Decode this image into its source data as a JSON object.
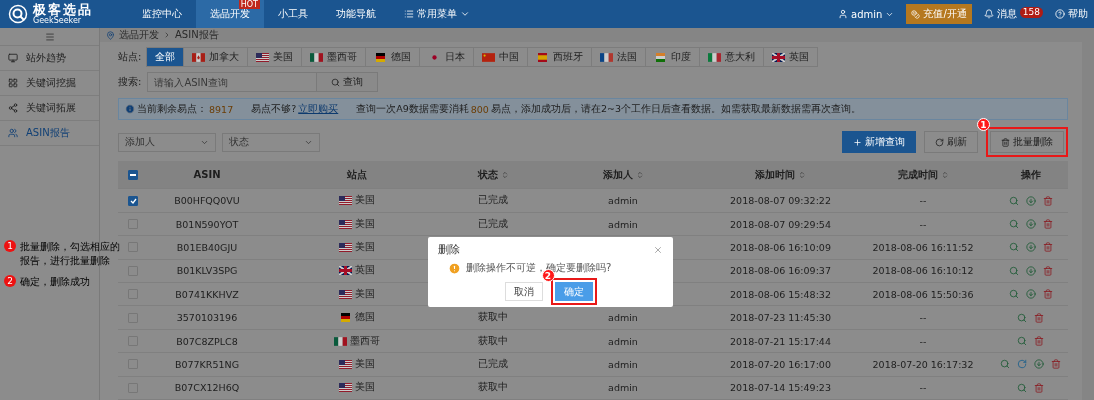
{
  "header": {
    "logo": {
      "name": "极客选品",
      "subtitle": "GeekSeeker"
    },
    "nav": [
      {
        "label": "监控中心",
        "selected": false
      },
      {
        "label": "选品开发",
        "selected": true,
        "badge": "HOT"
      },
      {
        "label": "小工具",
        "selected": false
      },
      {
        "label": "功能导航",
        "selected": false
      }
    ],
    "menu": {
      "label": "常用菜单"
    },
    "user": {
      "name": "admin"
    },
    "recharge": {
      "label": "充值/开通"
    },
    "messages": {
      "label": "消息",
      "count": "158"
    },
    "help": {
      "label": "帮助"
    }
  },
  "sidebar": {
    "items": [
      {
        "label": "站外趋势",
        "kind": "monitor",
        "selected": false
      },
      {
        "label": "关键词挖掘",
        "kind": "grid",
        "selected": false
      },
      {
        "label": "关键词拓展",
        "kind": "share",
        "selected": false
      },
      {
        "label": "ASIN报告",
        "kind": "users",
        "selected": true
      }
    ]
  },
  "breadcrumb": [
    "选品开发",
    "ASIN报告"
  ],
  "filters": {
    "site_label": "站点:",
    "sites": [
      {
        "label": "全部",
        "kind": "all",
        "selected": true
      },
      {
        "label": "加拿大",
        "kind": "ca",
        "selected": false
      },
      {
        "label": "美国",
        "kind": "us",
        "selected": false
      },
      {
        "label": "墨西哥",
        "kind": "mx",
        "selected": false
      },
      {
        "label": "德国",
        "kind": "de",
        "selected": false
      },
      {
        "label": "日本",
        "kind": "jp",
        "selected": false
      },
      {
        "label": "中国",
        "kind": "cn",
        "selected": false
      },
      {
        "label": "西班牙",
        "kind": "es",
        "selected": false
      },
      {
        "label": "法国",
        "kind": "fr",
        "selected": false
      },
      {
        "label": "印度",
        "kind": "in",
        "selected": false
      },
      {
        "label": "意大利",
        "kind": "it",
        "selected": false
      },
      {
        "label": "英国",
        "kind": "gb",
        "selected": false
      }
    ],
    "search_label": "搜索:",
    "search_placeholder": "请输入ASIN查询",
    "search_button": "查询"
  },
  "info": {
    "balance_label": "当前剩余易点：",
    "balance": "8917",
    "prompt": "易点不够?",
    "link": "立即购买",
    "notice_before": "查询一次A9数据需要消耗",
    "cost": "800",
    "notice_after": "易点，添加成功后，请在2~3个工作日后查看数据。如需获取最新数据需再次查询。"
  },
  "toolbar": {
    "selects": [
      {
        "placeholder": "添加人"
      },
      {
        "placeholder": "状态"
      }
    ],
    "buttons": [
      {
        "label": "新增查询",
        "kind": "add"
      },
      {
        "label": "刷新",
        "kind": "refresh"
      },
      {
        "label": "批量删除",
        "kind": "delete",
        "marker": "1"
      }
    ]
  },
  "table": {
    "select_all": {
      "checked": true,
      "indeterminate": true
    },
    "columns": [
      {
        "label": "ASIN",
        "sortable": false
      },
      {
        "label": "站点",
        "sortable": false
      },
      {
        "label": "状态",
        "sortable": true
      },
      {
        "label": "添加人",
        "sortable": true
      },
      {
        "label": "添加时间",
        "sortable": true
      },
      {
        "label": "完成时间",
        "sortable": true
      },
      {
        "label": "操作",
        "sortable": false
      }
    ],
    "rows": [
      {
        "checked": true,
        "asin": "B00HFQQ0VU",
        "site": "美国",
        "kind": "us",
        "status": "已完成",
        "adder": "admin",
        "added": "2018-08-07 09:32:22",
        "finished": "--",
        "actions": [
          {
            "kind": "search"
          },
          {
            "kind": "download"
          },
          {
            "kind": "delete"
          }
        ]
      },
      {
        "checked": false,
        "asin": "B01N590YOT",
        "site": "美国",
        "kind": "us",
        "status": "已完成",
        "adder": "admin",
        "added": "2018-08-07 09:29:54",
        "finished": "--",
        "actions": [
          {
            "kind": "search"
          },
          {
            "kind": "download"
          },
          {
            "kind": "delete"
          }
        ]
      },
      {
        "checked": false,
        "asin": "B01EB40GJU",
        "site": "美国",
        "kind": "us",
        "added": "2018-08-06 16:10:09",
        "finished": "2018-08-06 16:11:52",
        "actions": [
          {
            "kind": "search"
          },
          {
            "kind": "download"
          },
          {
            "kind": "delete"
          }
        ]
      },
      {
        "checked": false,
        "asin": "B01KLV3SPG",
        "site": "英国",
        "kind": "gb",
        "added": "2018-08-06 16:09:37",
        "finished": "2018-08-06 16:10:12",
        "actions": [
          {
            "kind": "search"
          },
          {
            "kind": "download"
          },
          {
            "kind": "delete"
          }
        ]
      },
      {
        "checked": false,
        "asin": "B0741KKHVZ",
        "site": "美国",
        "kind": "us",
        "added": "2018-08-06 15:48:32",
        "finished": "2018-08-06 15:50:36",
        "actions": [
          {
            "kind": "search"
          },
          {
            "kind": "download"
          },
          {
            "kind": "delete"
          }
        ]
      },
      {
        "checked": false,
        "asin": "3570103196",
        "site": "德国",
        "kind": "de",
        "status": "获取中",
        "adder": "admin",
        "added": "2018-07-23 11:45:30",
        "finished": "--",
        "actions": [
          {
            "kind": "search"
          },
          {
            "kind": "delete"
          }
        ]
      },
      {
        "checked": false,
        "asin": "B07C8ZPLC8",
        "site": "墨西哥",
        "kind": "mx",
        "status": "获取中",
        "adder": "admin",
        "added": "2018-07-21 15:17:44",
        "finished": "--",
        "actions": [
          {
            "kind": "search"
          },
          {
            "kind": "delete"
          }
        ]
      },
      {
        "checked": false,
        "asin": "B077KR51NG",
        "site": "美国",
        "kind": "us",
        "status": "已完成",
        "adder": "admin",
        "added": "2018-07-20 16:17:00",
        "finished": "2018-07-20 16:17:32",
        "actions": [
          {
            "kind": "search"
          },
          {
            "kind": "refresh"
          },
          {
            "kind": "download"
          },
          {
            "kind": "delete"
          }
        ]
      },
      {
        "checked": false,
        "asin": "B07CX12H6Q",
        "site": "美国",
        "kind": "us",
        "status": "获取中",
        "adder": "admin",
        "added": "2018-07-14 15:49:23",
        "finished": "--",
        "actions": [
          {
            "kind": "search"
          },
          {
            "kind": "delete"
          }
        ]
      }
    ]
  },
  "dialog": {
    "title": "删除",
    "message": "删除操作不可逆，确定要删除吗?",
    "buttons": [
      {
        "label": "取消",
        "primary": false
      },
      {
        "label": "确定",
        "primary": true,
        "marker": "2"
      }
    ]
  },
  "annotations": [
    {
      "number": "1",
      "text": "批量删除，勾选相应的报告，进行批量删除"
    },
    {
      "number": "2",
      "text": "确定，删除成功"
    }
  ]
}
